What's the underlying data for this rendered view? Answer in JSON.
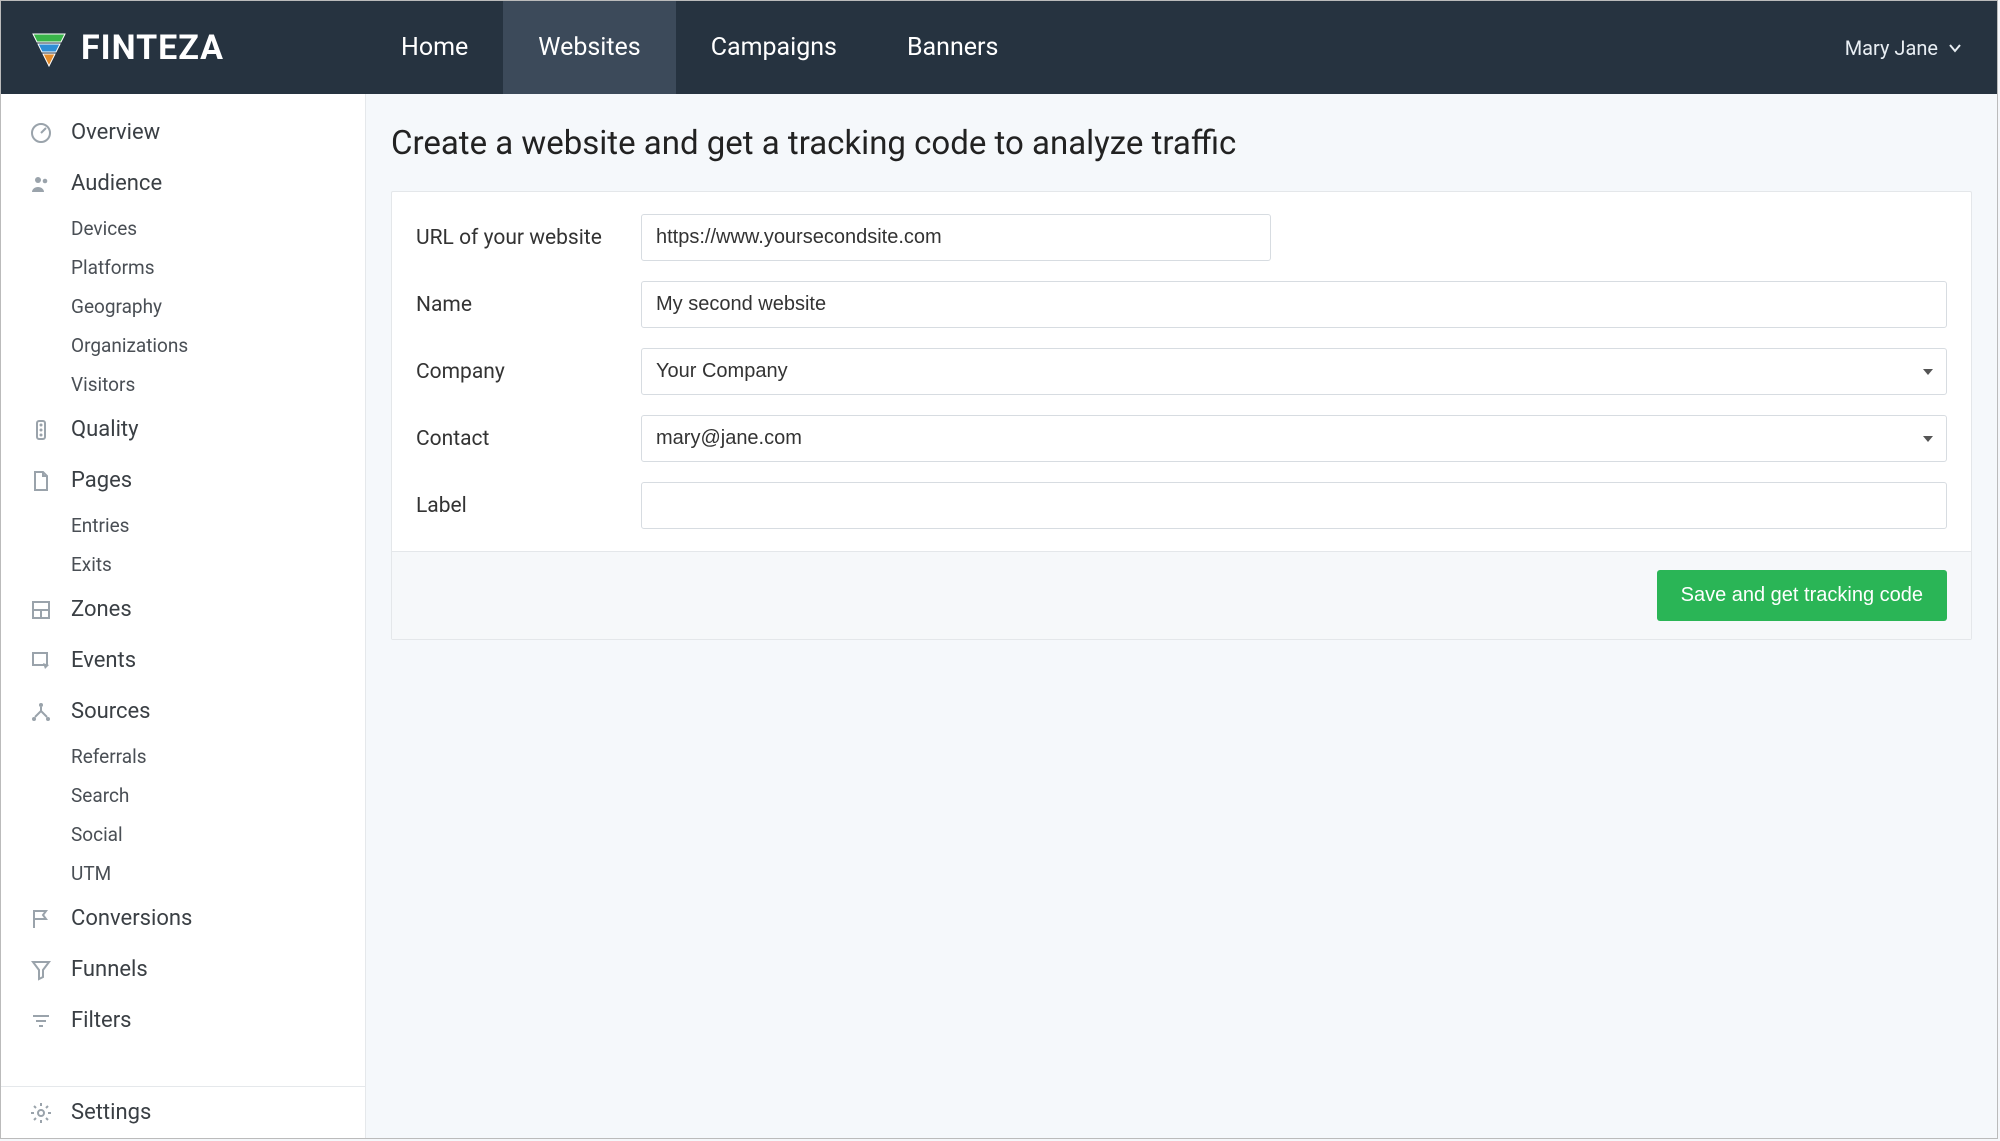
{
  "brand": {
    "name": "FINTEZA"
  },
  "topnav": {
    "items": [
      {
        "label": "Home"
      },
      {
        "label": "Websites"
      },
      {
        "label": "Campaigns"
      },
      {
        "label": "Banners"
      }
    ]
  },
  "user": {
    "name": "Mary Jane"
  },
  "sidebar": {
    "overview": "Overview",
    "audience": {
      "label": "Audience",
      "items": [
        "Devices",
        "Platforms",
        "Geography",
        "Organizations",
        "Visitors"
      ]
    },
    "quality": "Quality",
    "pages": {
      "label": "Pages",
      "items": [
        "Entries",
        "Exits"
      ]
    },
    "zones": "Zones",
    "events": "Events",
    "sources": {
      "label": "Sources",
      "items": [
        "Referrals",
        "Search",
        "Social",
        "UTM"
      ]
    },
    "conversions": "Conversions",
    "funnels": "Funnels",
    "filters": "Filters",
    "settings": "Settings"
  },
  "page": {
    "title": "Create a website and get a tracking code to analyze traffic"
  },
  "form": {
    "url": {
      "label": "URL of your website",
      "value": "https://www.yoursecondsite.com"
    },
    "name": {
      "label": "Name",
      "value": "My second website"
    },
    "company": {
      "label": "Company",
      "value": "Your Company"
    },
    "contact": {
      "label": "Contact",
      "value": "mary@jane.com"
    },
    "labelf": {
      "label": "Label",
      "value": ""
    },
    "submit": "Save and get tracking code"
  }
}
